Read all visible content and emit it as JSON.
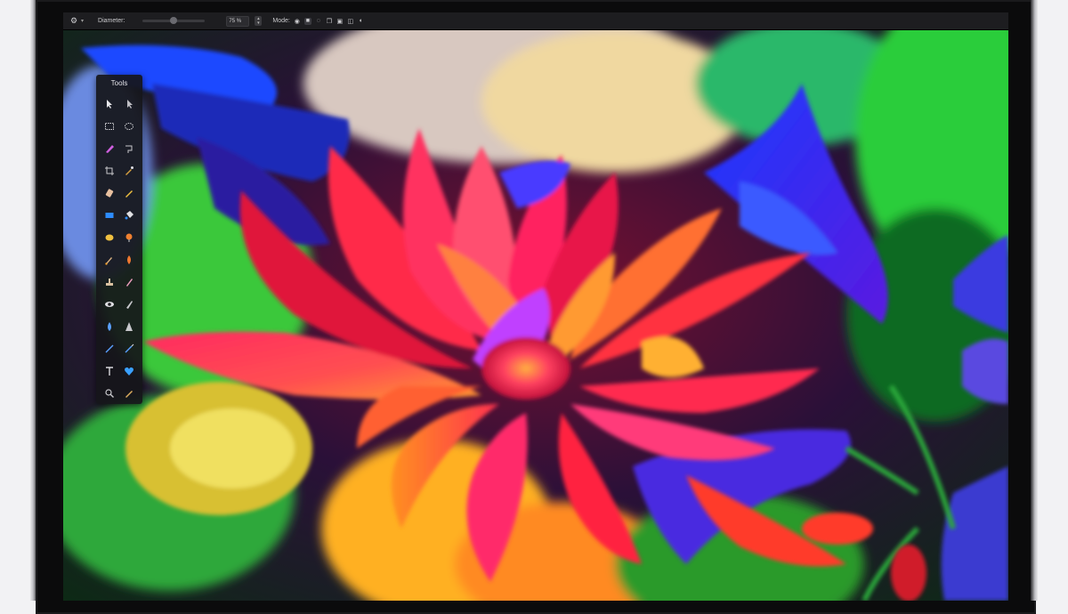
{
  "options_bar": {
    "settings_icon": "gear-icon",
    "diameter_label": "Diameter:",
    "diameter_value": "75 %",
    "mode_label": "Mode:",
    "mode_buttons": [
      "mode-normal-icon",
      "mode-square-icon",
      "mode-copy-icon",
      "mode-stack-icon",
      "mode-overlay-icon",
      "mode-clip-icon",
      "mode-circle-icon"
    ]
  },
  "tools_palette": {
    "title": "Tools",
    "tools": [
      {
        "name": "pointer-icon"
      },
      {
        "name": "move-icon"
      },
      {
        "name": "rect-select-icon"
      },
      {
        "name": "ellipse-select-icon"
      },
      {
        "name": "lasso-icon"
      },
      {
        "name": "magic-wand-icon"
      },
      {
        "name": "crop-icon"
      },
      {
        "name": "eyedropper-icon"
      },
      {
        "name": "eraser-icon"
      },
      {
        "name": "pencil-icon"
      },
      {
        "name": "rectangle-shape-icon"
      },
      {
        "name": "paint-bucket-icon"
      },
      {
        "name": "sponge-icon"
      },
      {
        "name": "gradient-icon"
      },
      {
        "name": "brush-icon"
      },
      {
        "name": "burn-icon"
      },
      {
        "name": "clone-stamp-icon"
      },
      {
        "name": "smudge-icon"
      },
      {
        "name": "red-eye-icon"
      },
      {
        "name": "sharpen-icon"
      },
      {
        "name": "blur-drop-icon"
      },
      {
        "name": "cone-icon"
      },
      {
        "name": "line-icon"
      },
      {
        "name": "pen-icon"
      },
      {
        "name": "type-icon"
      },
      {
        "name": "heart-shape-icon"
      },
      {
        "name": "zoom-icon"
      },
      {
        "name": "heal-icon"
      }
    ]
  },
  "colors": {
    "bezel": "#0b0b0c",
    "toolbar": "#1d1d20",
    "palette": "#16161a",
    "accent_blue": "#2d8cff"
  }
}
